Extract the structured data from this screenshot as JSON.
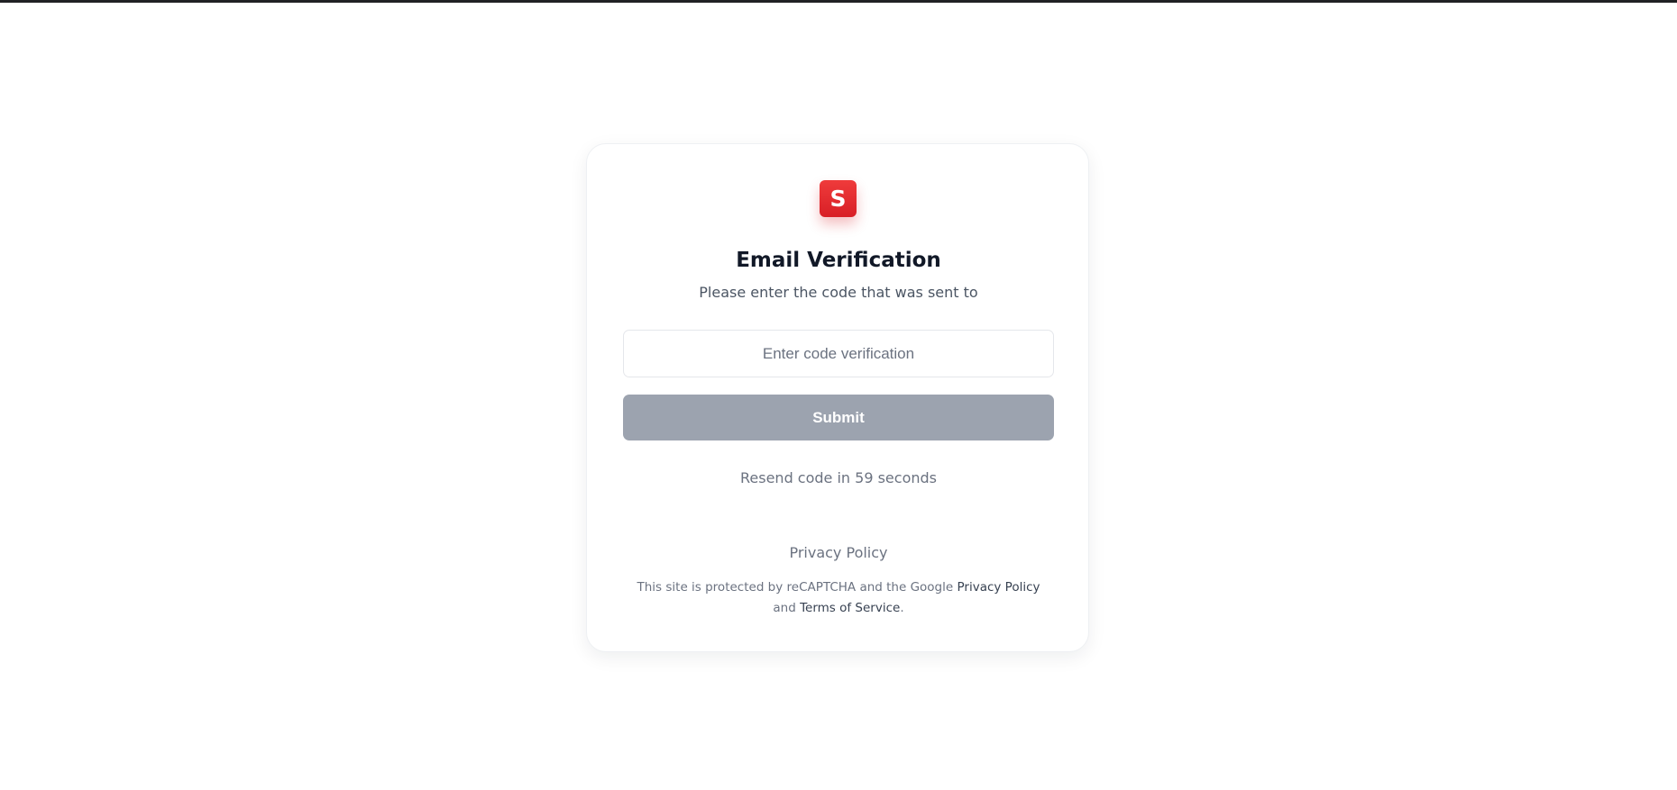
{
  "logo": {
    "letter": "S",
    "color": "#e12d2f"
  },
  "verification": {
    "title": "Email Verification",
    "subtitle": "Please enter the code that was sent to",
    "code_input": {
      "value": "",
      "placeholder": "Enter code verification"
    },
    "submit_label": "Submit",
    "resend_text": "Resend code in 59 seconds"
  },
  "footer": {
    "privacy_link": "Privacy Policy",
    "recaptcha_prefix": "This site is protected by reCAPTCHA and the Google",
    "recaptcha_privacy": "Privacy Policy",
    "recaptcha_and": "and",
    "recaptcha_terms": "Terms of Service",
    "recaptcha_end": "."
  },
  "colors": {
    "brand": "#e12d2f",
    "button_disabled": "#9ca3af",
    "heading": "#111827",
    "muted_text": "#6b7280"
  }
}
